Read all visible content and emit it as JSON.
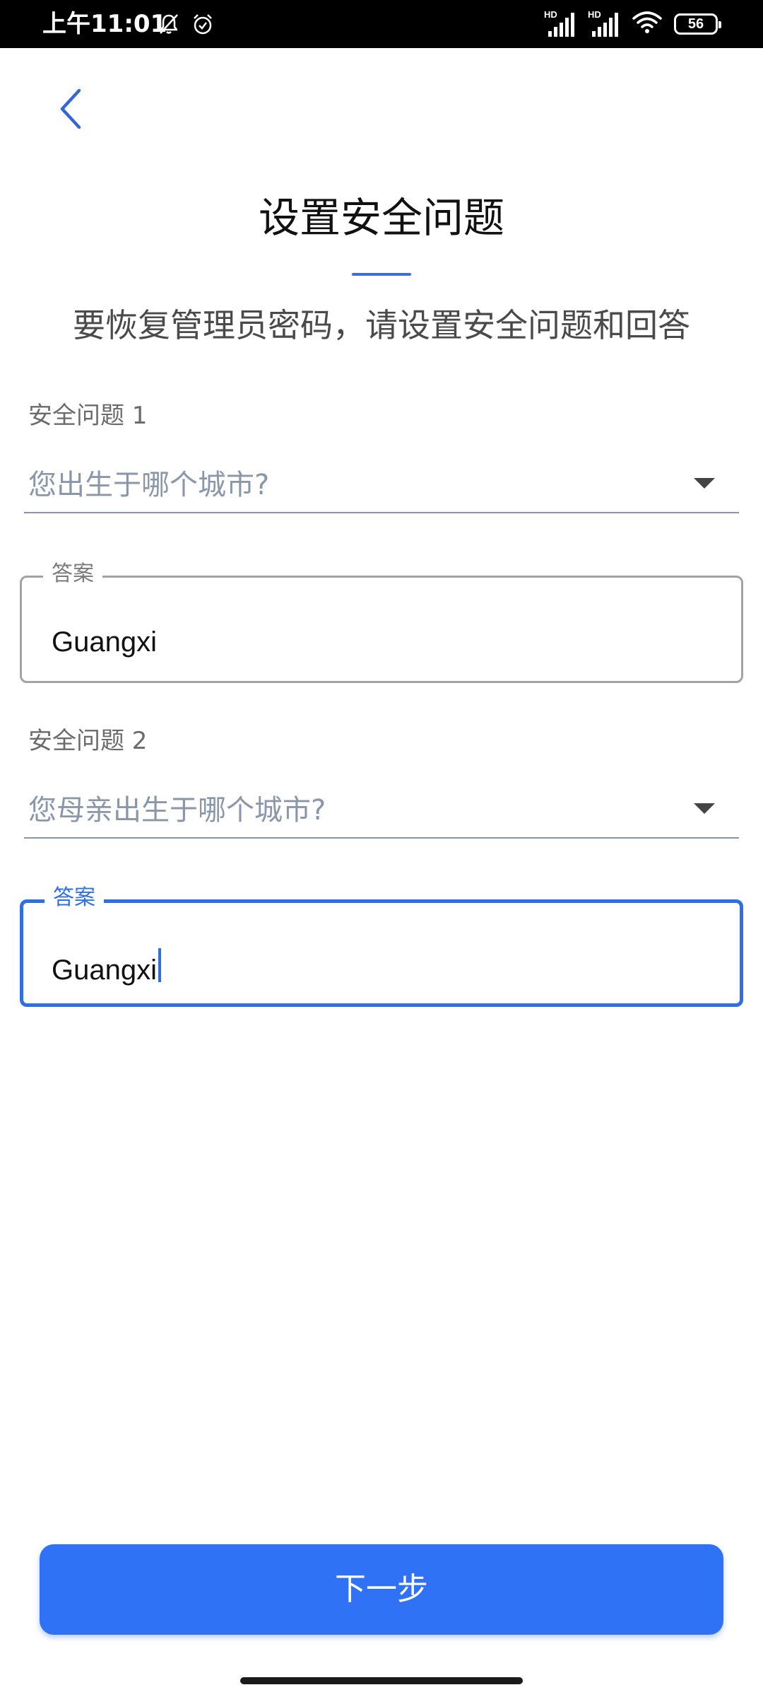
{
  "status_bar": {
    "time": "上午11:01",
    "hd_1": "HD",
    "hd_2": "HD",
    "battery": "56",
    "icons": [
      "bell-off-icon",
      "alarm-icon",
      "signal-icon",
      "signal-icon",
      "wifi-icon",
      "battery-icon"
    ]
  },
  "header": {
    "back_icon": "chevron-left-icon",
    "title": "设置安全问题",
    "subtitle": "要恢复管理员密码，请设置安全问题和回答"
  },
  "form": {
    "question1": {
      "label": "安全问题 1",
      "selected": "您出生于哪个城市?"
    },
    "answer1": {
      "label": "答案",
      "value": "Guangxi"
    },
    "question2": {
      "label": "安全问题 2",
      "selected": "您母亲出生于哪个城市?"
    },
    "answer2": {
      "label": "答案",
      "value": "Guangxi",
      "focused": true
    }
  },
  "footer": {
    "next_label": "下一步"
  },
  "colors": {
    "accent": "#3072f6",
    "focus": "#2f6fe4",
    "divider": "#3d6fd6"
  }
}
